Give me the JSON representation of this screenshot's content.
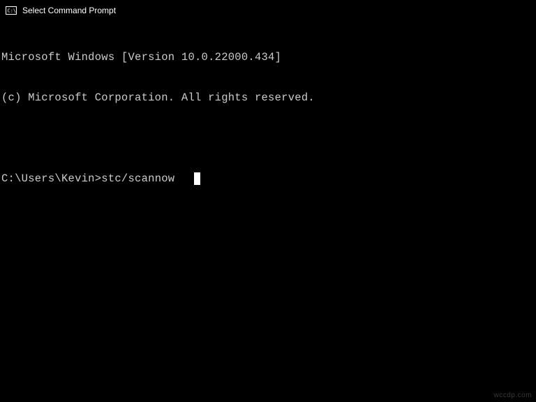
{
  "titlebar": {
    "title": "Select Command Prompt"
  },
  "terminal": {
    "line1": "Microsoft Windows [Version 10.0.22000.434]",
    "line2": "(c) Microsoft Corporation. All rights reserved.",
    "prompt": "C:\\Users\\Kevin>",
    "command": "stc/scannow"
  },
  "watermark": "wccdp.com"
}
